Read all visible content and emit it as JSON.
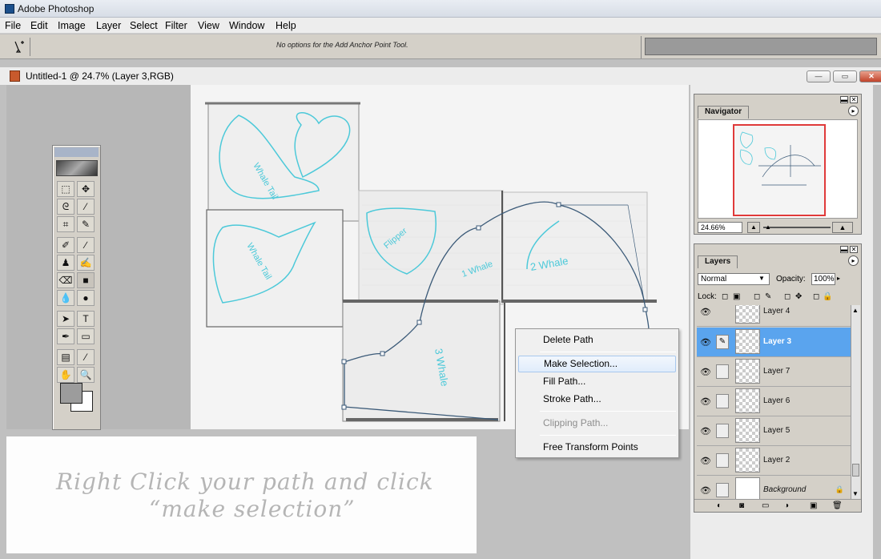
{
  "window": {
    "title": "Adobe Photoshop"
  },
  "menu": [
    "File",
    "Edit",
    "Image",
    "Layer",
    "Select",
    "Filter",
    "View",
    "Window",
    "Help"
  ],
  "options_bar": {
    "tool_icon": "add-anchor-point-pen-icon",
    "message": "No options for the Add Anchor Point Tool."
  },
  "document": {
    "title": "Untitled-1 @ 24.7% (Layer 3,RGB)",
    "window_buttons": [
      "minimize",
      "restore",
      "close"
    ]
  },
  "canvas_sketches": {
    "whale_tail_1": "Whale Tail",
    "whale_tail_2": "Whale Tail",
    "flipper": "Flipper",
    "whale_1": "1 Whale",
    "whale_2": "2 Whale",
    "whale_3": "3 Whale"
  },
  "navigator": {
    "tab": "Navigator",
    "zoom": "24.66%",
    "frame_color": "#e03a3a"
  },
  "layers_panel": {
    "tab": "Layers",
    "blend_mode": "Normal",
    "opacity_label": "Opacity:",
    "opacity_value": "100%",
    "lock_label": "Lock:",
    "layers": [
      {
        "name": "Layer 4",
        "partial": true
      },
      {
        "name": "Layer 3",
        "selected": true
      },
      {
        "name": "Layer 7"
      },
      {
        "name": "Layer 6"
      },
      {
        "name": "Layer 5"
      },
      {
        "name": "Layer 2"
      },
      {
        "name": "Background",
        "locked": true
      }
    ]
  },
  "context_menu": {
    "items": [
      {
        "label": "Delete Path",
        "state": "normal"
      },
      {
        "label": "Make Selection...",
        "state": "hover"
      },
      {
        "label": "Fill Path...",
        "state": "normal"
      },
      {
        "label": "Stroke Path...",
        "state": "normal"
      },
      {
        "label": "Clipping Path...",
        "state": "disabled"
      },
      {
        "label": "Free Transform Points",
        "state": "normal"
      }
    ]
  },
  "caption": {
    "line1": "Right Click your path and click",
    "line2": "“make selection”"
  },
  "colors": {
    "selection_blue": "#5aa4ee",
    "sketch_cyan": "#4cc9d9",
    "path_color": "#3b5a78"
  }
}
